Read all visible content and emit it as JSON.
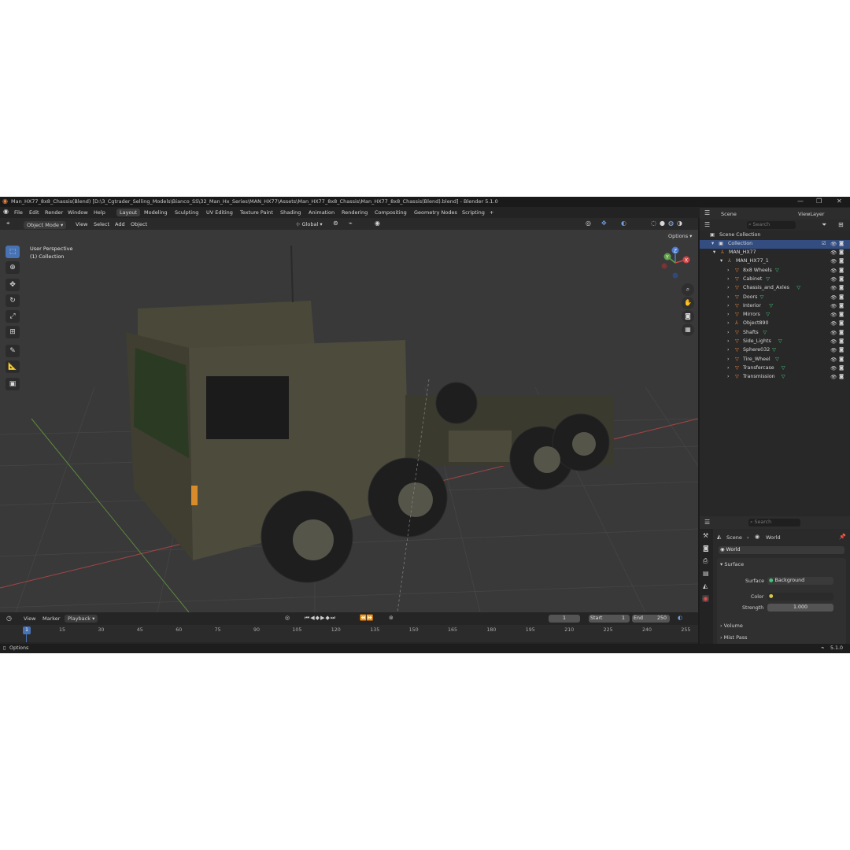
{
  "window": {
    "title": "Man_HX77_8x8_Chassis(Blend) [D:\\3_Cgtrader_Selling_Models\\Bianco_SS\\32_Man_Hx_Series\\MAN_HX77\\Assets\\Man_HX77_8x8_Chassis\\Man_HX77_8x8_Chassis(Blend).blend] - Blender 5.1.0",
    "controls": [
      "—",
      "❐",
      "✕"
    ]
  },
  "menu": {
    "items": [
      "File",
      "Edit",
      "Render",
      "Window",
      "Help"
    ],
    "workspaces": [
      "Layout",
      "Modeling",
      "Sculpting",
      "UV Editing",
      "Texture Paint",
      "Shading",
      "Animation",
      "Rendering",
      "Compositing",
      "Geometry Nodes",
      "Scripting"
    ],
    "active_workspace": "Layout",
    "add_tab": "+"
  },
  "viewport_header": {
    "mode": "Object Mode",
    "menus": [
      "View",
      "Select",
      "Add",
      "Object"
    ],
    "transform_orientation": "Global",
    "options_label": "Options"
  },
  "viewport": {
    "view_name": "User Perspective",
    "collection_label": "(1) Collection",
    "gizmo": {
      "z": "Z",
      "y": "Y",
      "x": "X"
    },
    "tools": [
      "select-box",
      "cursor",
      "move",
      "rotate",
      "scale",
      "transform",
      "annotate",
      "measure",
      "add-cube"
    ]
  },
  "outliner": {
    "scene": "Scene",
    "view_layer": "ViewLayer",
    "search_placeholder": "Search",
    "root": "Scene Collection",
    "collection": "Collection",
    "items": [
      {
        "label": "MAN_HX77",
        "depth": 1,
        "kind": "empty"
      },
      {
        "label": "MAN_HX77_1",
        "depth": 2,
        "kind": "empty"
      },
      {
        "label": "8x8 Wheels",
        "depth": 3,
        "kind": "mesh"
      },
      {
        "label": "Cabinet",
        "depth": 3,
        "kind": "mesh"
      },
      {
        "label": "Chassis_and_Axles",
        "depth": 3,
        "kind": "mesh"
      },
      {
        "label": "Doors",
        "depth": 3,
        "kind": "mesh"
      },
      {
        "label": "Interior",
        "depth": 3,
        "kind": "mesh"
      },
      {
        "label": "Mirrors",
        "depth": 3,
        "kind": "mesh"
      },
      {
        "label": "Object890",
        "depth": 3,
        "kind": "empty"
      },
      {
        "label": "Shafts",
        "depth": 3,
        "kind": "mesh"
      },
      {
        "label": "Side_Lights",
        "depth": 3,
        "kind": "mesh"
      },
      {
        "label": "Sphere032",
        "depth": 3,
        "kind": "mesh"
      },
      {
        "label": "Tire_Wheel",
        "depth": 3,
        "kind": "mesh"
      },
      {
        "label": "Transfercase",
        "depth": 3,
        "kind": "mesh"
      },
      {
        "label": "Transmission",
        "depth": 3,
        "kind": "mesh"
      }
    ]
  },
  "properties": {
    "search_placeholder": "Search",
    "breadcrumb": [
      "Scene",
      "World"
    ],
    "world_name": "World",
    "surface_panel": "Surface",
    "surface_label": "Surface",
    "surface_value": "Background",
    "color_label": "Color",
    "strength_label": "Strength",
    "strength_value": "1.000",
    "volume_panel": "Volume",
    "mist_panel": "Mist Pass"
  },
  "timeline": {
    "menus": [
      "View",
      "Marker",
      "Playback"
    ],
    "current_frame": "1",
    "start_label": "Start",
    "start_value": "1",
    "end_label": "End",
    "end_value": "250",
    "ruler": [
      "15",
      "30",
      "45",
      "60",
      "75",
      "90",
      "105",
      "120",
      "135",
      "150",
      "165",
      "180",
      "195",
      "210",
      "225",
      "240",
      "255"
    ],
    "playhead_label": "1"
  },
  "statusbar": {
    "left": "Options",
    "version": "5.1.0"
  },
  "colors": {
    "accent": "#4772b3",
    "viewport_bg": "#393939",
    "panel_bg": "#282828",
    "mesh_icon": "#44c67a",
    "object_icon": "#e7843f"
  }
}
